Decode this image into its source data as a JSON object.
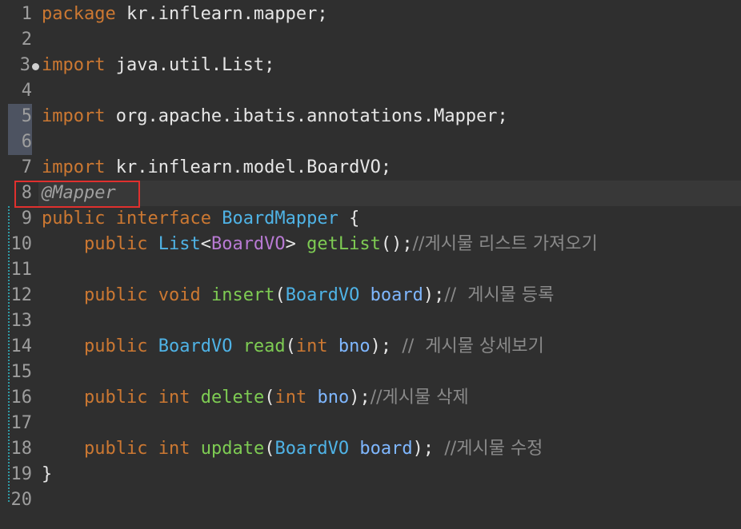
{
  "editor": {
    "lines": [
      {
        "n": "1",
        "text": "package kr.inflearn.mapper;"
      },
      {
        "n": "2",
        "text": ""
      },
      {
        "n": "3",
        "text": "import java.util.List;"
      },
      {
        "n": "4",
        "text": ""
      },
      {
        "n": "5",
        "text": "import org.apache.ibatis.annotations.Mapper;"
      },
      {
        "n": "6",
        "text": ""
      },
      {
        "n": "7",
        "text": "import kr.inflearn.model.BoardVO;"
      },
      {
        "n": "8",
        "text": "@Mapper"
      },
      {
        "n": "9",
        "text": "public interface BoardMapper {"
      },
      {
        "n": "10",
        "text": "    public List<BoardVO> getList();//게시물 리스트 가져오기"
      },
      {
        "n": "11",
        "text": ""
      },
      {
        "n": "12",
        "text": "    public void insert(BoardVO board);//  게시물 등록"
      },
      {
        "n": "13",
        "text": ""
      },
      {
        "n": "14",
        "text": "    public BoardVO read(int bno); //  게시물 상세보기"
      },
      {
        "n": "15",
        "text": ""
      },
      {
        "n": "16",
        "text": "    public int delete(int bno);//게시물 삭제"
      },
      {
        "n": "17",
        "text": ""
      },
      {
        "n": "18",
        "text": "    public int update(BoardVO board); //게시물 수정"
      },
      {
        "n": "19",
        "text": "}"
      },
      {
        "n": "20",
        "text": ""
      }
    ],
    "tokens": {
      "l1_kw": "package",
      "l1_rest": " kr.inflearn.mapper;",
      "l3_kw": "import",
      "l3_rest": " java.util.List;",
      "l5_kw": "import",
      "l5_rest": " org.apache.ibatis.annotations.Mapper;",
      "l7_kw": "import",
      "l7_rest": " kr.inflearn.model.BoardVO;",
      "l8_anno": "@Mapper",
      "l9_kw1": "public",
      "l9_kw2": "interface",
      "l9_type": "BoardMapper",
      "l9_brace": " {",
      "l10_kw": "public",
      "l10_type": "List",
      "l10_lt": "<",
      "l10_gen": "BoardVO",
      "l10_gt": ">",
      "l10_method": "getList",
      "l10_punc": "();",
      "l10_comment": "//게시물 리스트 가져오기",
      "l12_kw1": "public",
      "l12_kw2": "void",
      "l12_method": "insert",
      "l12_open": "(",
      "l12_type": "BoardVO",
      "l12_param": "board",
      "l12_close": ");",
      "l12_comment": "//  게시물 등록",
      "l14_kw": "public",
      "l14_type": "BoardVO",
      "l14_method": "read",
      "l14_open": "(",
      "l14_kw2": "int",
      "l14_param": "bno",
      "l14_close": ");",
      "l14_comment": "//  게시물 상세보기",
      "l16_kw1": "public",
      "l16_kw2": "int",
      "l16_method": "delete",
      "l16_open": "(",
      "l16_kw3": "int",
      "l16_param": "bno",
      "l16_close": ");",
      "l16_comment": "//게시물 삭제",
      "l18_kw1": "public",
      "l18_kw2": "int",
      "l18_method": "update",
      "l18_open": "(",
      "l18_type": "BoardVO",
      "l18_param": "board",
      "l18_close": ");",
      "l18_comment": "//게시물 수정",
      "l19_brace": "}"
    }
  },
  "colors": {
    "background": "#2f2f2f",
    "keyword": "#cc7832",
    "type": "#4fb3e6",
    "generic": "#b87ad3",
    "method": "#7ecc53",
    "parameter": "#7fb7ff",
    "comment": "#8a8a8a",
    "highlight_box": "#e0302e"
  },
  "icons": {
    "fold_marker": "fold-collapse-dot-icon"
  }
}
